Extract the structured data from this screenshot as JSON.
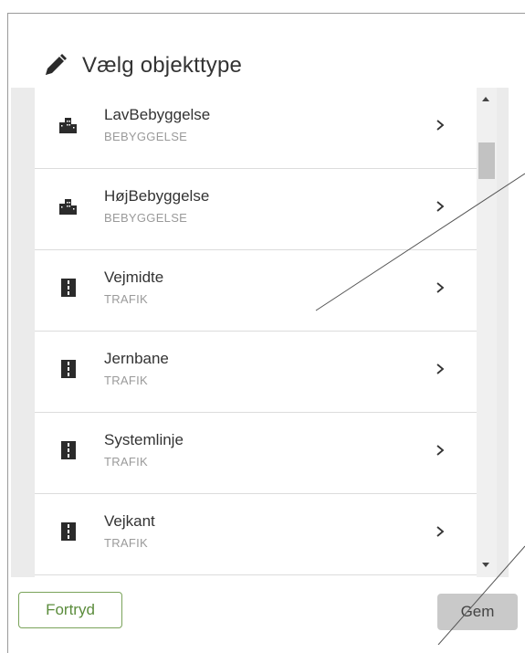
{
  "dialog": {
    "title": "Vælg objekttype",
    "title_icon": "pencil-icon"
  },
  "list": {
    "items": [
      {
        "name": "LavBebyggelse",
        "category": "BEBYGGELSE",
        "icon": "buildings-icon"
      },
      {
        "name": "HøjBebyggelse",
        "category": "BEBYGGELSE",
        "icon": "buildings-icon"
      },
      {
        "name": "Vejmidte",
        "category": "TRAFIK",
        "icon": "road-icon"
      },
      {
        "name": "Jernbane",
        "category": "TRAFIK",
        "icon": "road-icon"
      },
      {
        "name": "Systemlinje",
        "category": "TRAFIK",
        "icon": "road-icon"
      },
      {
        "name": "Vejkant",
        "category": "TRAFIK",
        "icon": "road-icon"
      }
    ],
    "chevron": ">"
  },
  "buttons": {
    "cancel_label": "Fortryd",
    "save_label": "Gem"
  },
  "colors": {
    "accent": "#5b8c3c",
    "save_disabled_bg": "#c9c9c9",
    "panel_bg": "#ebebeb"
  }
}
